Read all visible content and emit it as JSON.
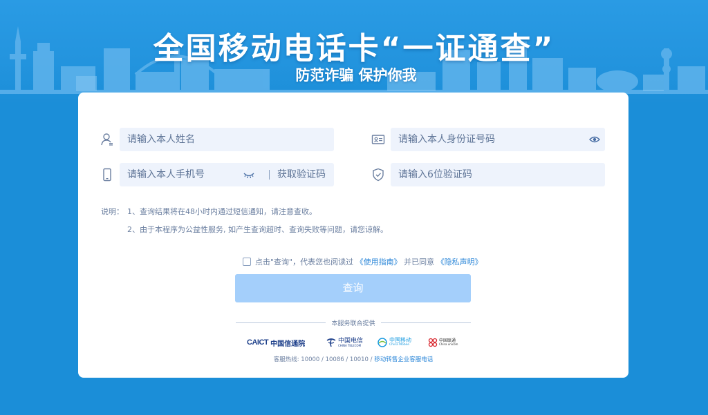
{
  "header": {
    "title": "全国移动电话卡“一证通查”",
    "subtitle": "防范诈骗 保护你我"
  },
  "form": {
    "name_placeholder": "请输入本人姓名",
    "id_placeholder": "请输入本人身份证号码",
    "phone_placeholder": "请输入本人手机号",
    "get_code_label": "获取验证码",
    "code_placeholder": "请输入6位验证码"
  },
  "notes": {
    "label": "说明：",
    "items": [
      "1、查询结果将在48小时内通过短信通知，请注意查收。",
      "2、由于本程序为公益性服务, 如产生查询超时、查询失败等问题，请您谅解。"
    ]
  },
  "agreement": {
    "prefix": "点击\"查询\"，代表您也阅读过",
    "guide_link": "《使用指南》",
    "middle": "并已同意",
    "privacy_link": "《隐私声明》"
  },
  "query_button_label": "查询",
  "footer": {
    "provided_by": "本服务联合提供",
    "logos": [
      {
        "name": "CAICT",
        "label": "中国信通院"
      },
      {
        "name": "china-telecom",
        "label": "中国电信",
        "sub": "CHINA TELECOM"
      },
      {
        "name": "china-mobile",
        "label": "中国移动",
        "sub": "China Mobile"
      },
      {
        "name": "china-unicom",
        "label": "中国联通",
        "sub": "China unicom"
      }
    ],
    "hotline_prefix": "客服热线: 10000 / 10086 / 10010 /",
    "hotline_link": "移动转售企业客服电话"
  },
  "colors": {
    "background": "#1b8ed8",
    "card": "#ffffff",
    "input_bg": "#eef3fc",
    "button_disabled": "#a4cffb",
    "link": "#2a86d8"
  }
}
